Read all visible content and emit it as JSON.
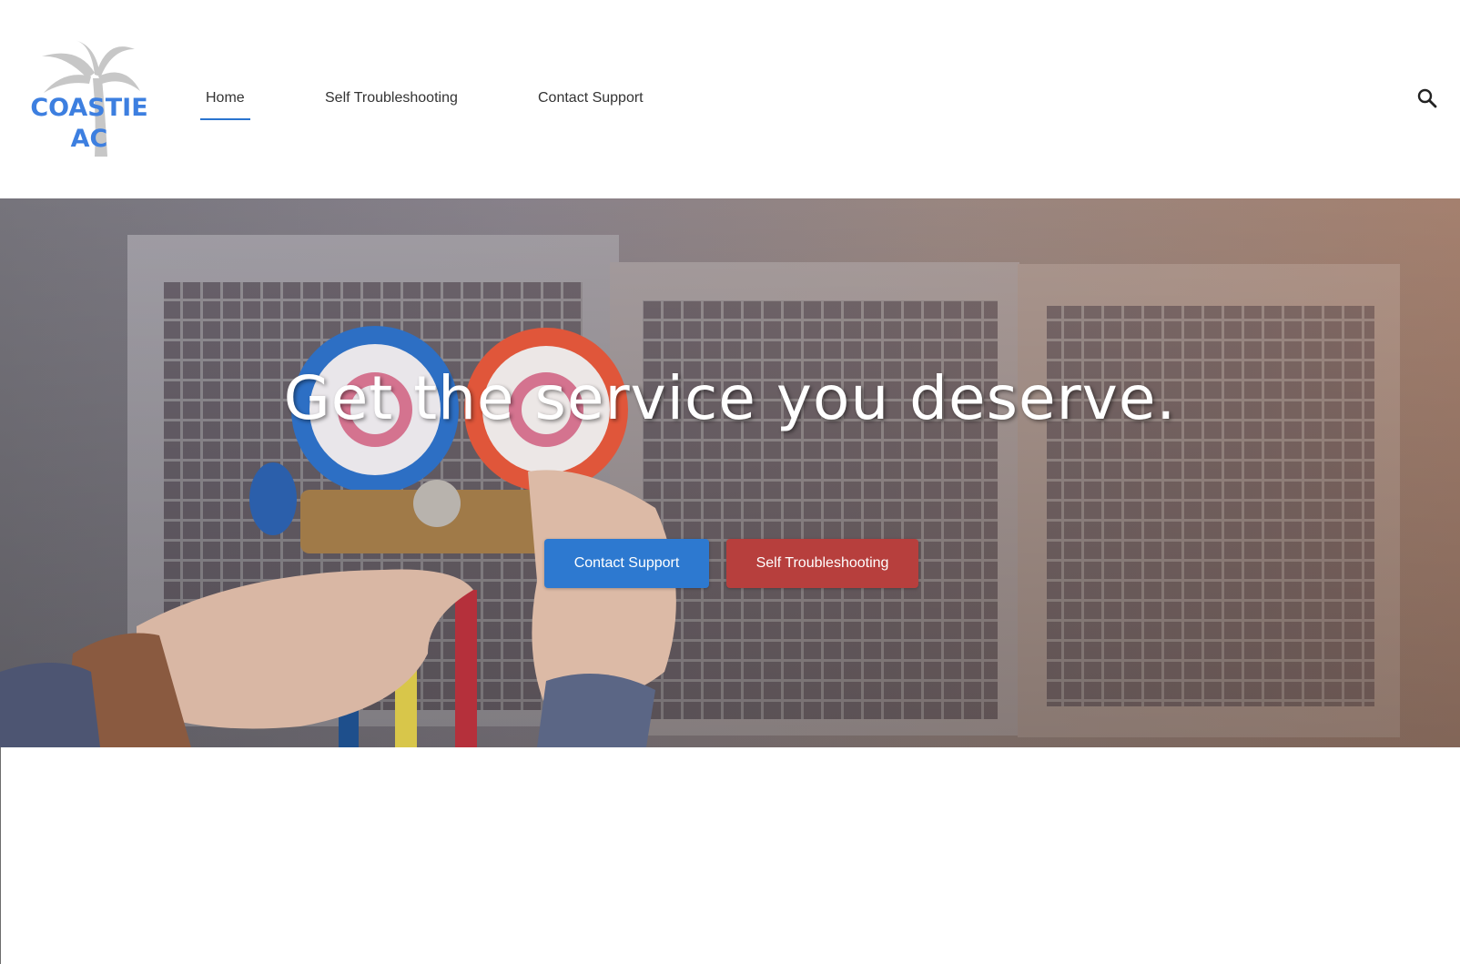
{
  "logo": {
    "line1": "COASTIE",
    "line2": "AC",
    "icon": "palm-tree-icon",
    "text_color": "#3d7fe0"
  },
  "nav": {
    "items": [
      {
        "label": "Home",
        "active": true
      },
      {
        "label": "Self Troubleshooting",
        "active": false
      },
      {
        "label": "Contact Support",
        "active": false
      }
    ],
    "active_color": "#2a74cf"
  },
  "search": {
    "icon": "search-icon"
  },
  "hero": {
    "title": "Get the service you deserve.",
    "buttons": [
      {
        "label": "Contact Support",
        "color": "#2d79d0"
      },
      {
        "label": "Self Troubleshooting",
        "color": "#b73f3d"
      }
    ]
  }
}
